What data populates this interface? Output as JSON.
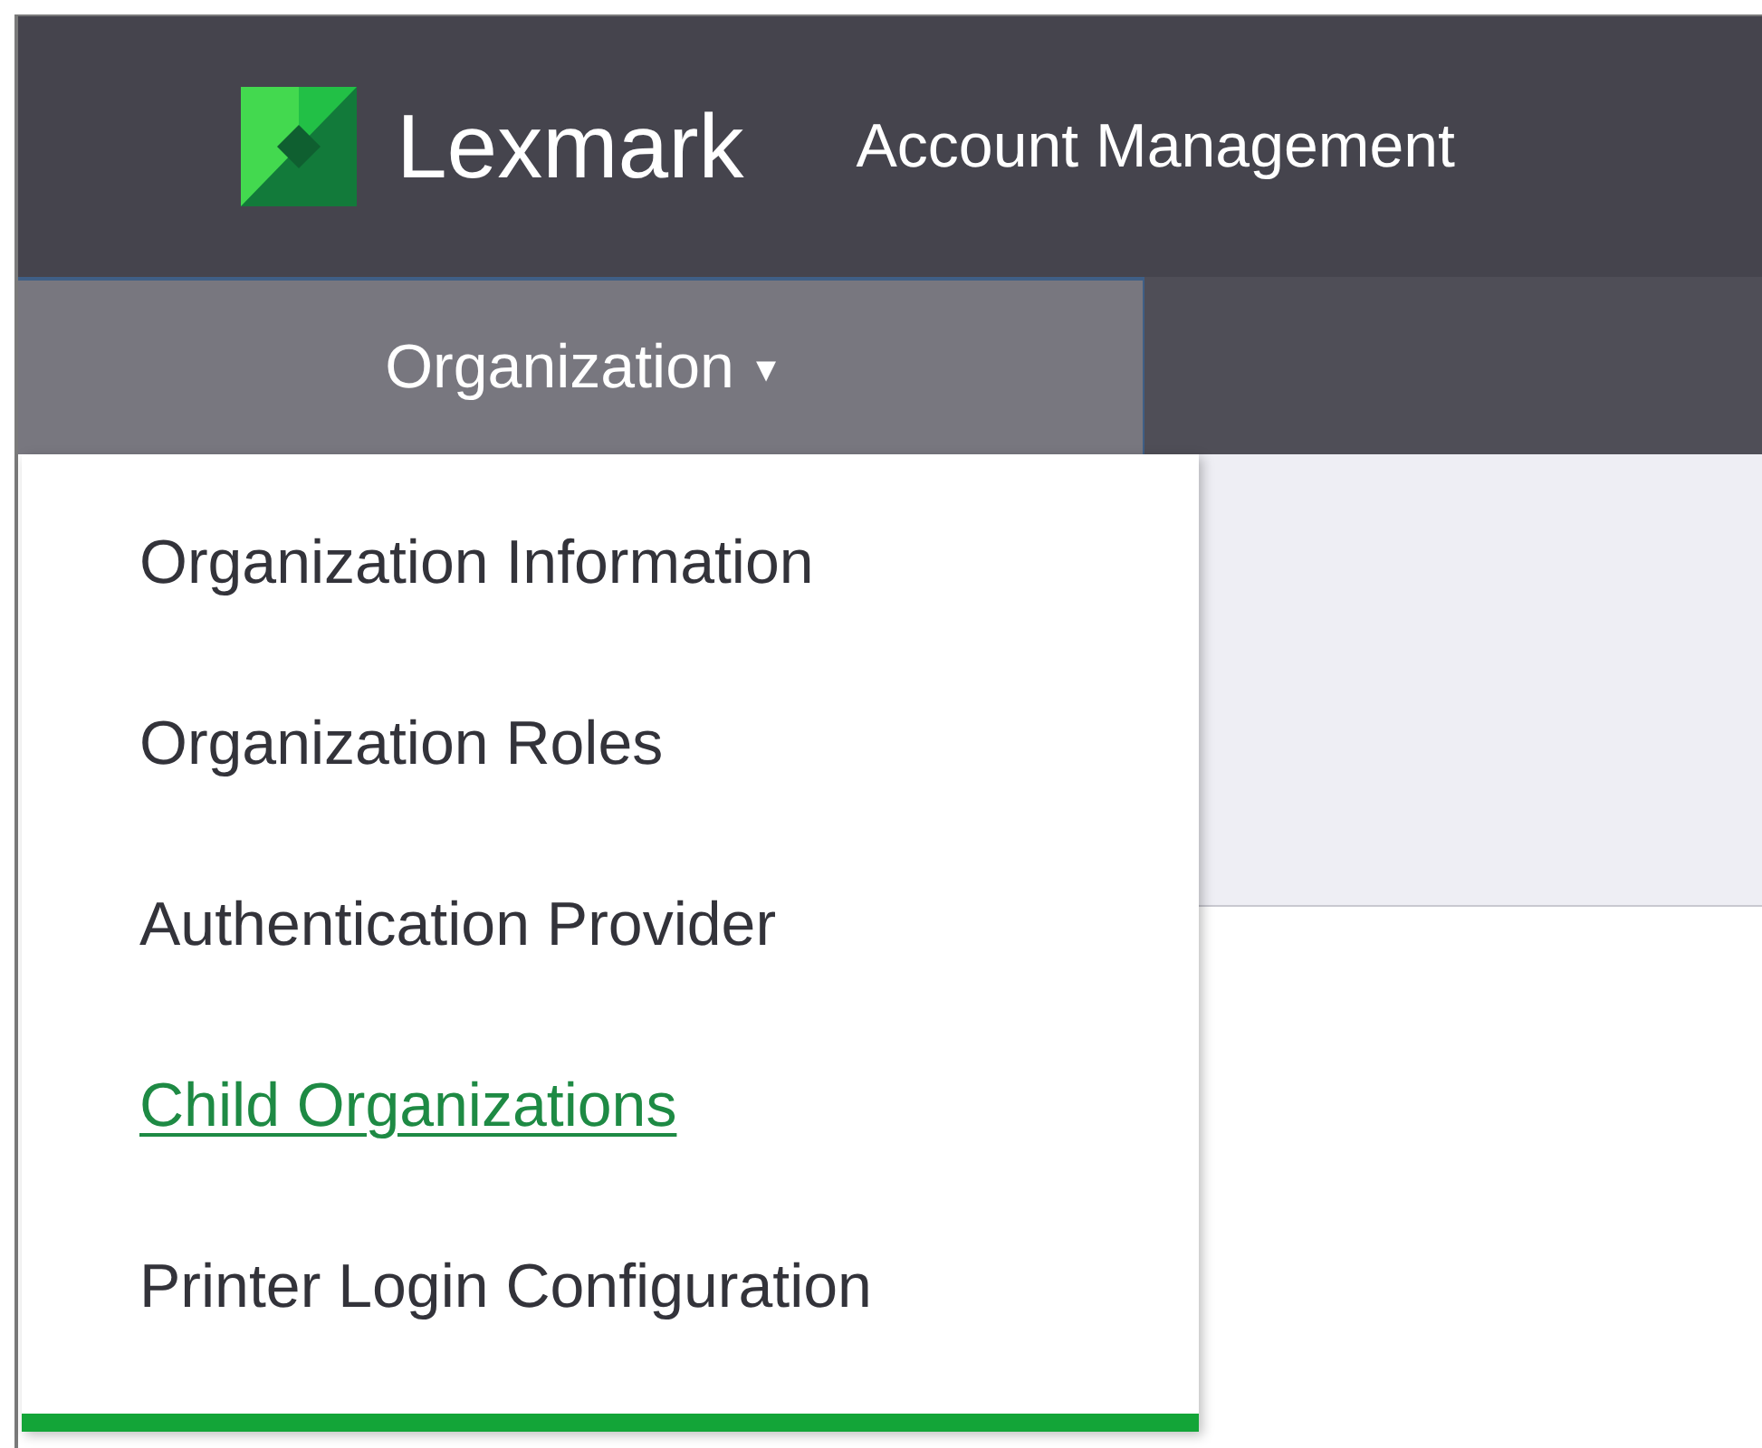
{
  "header": {
    "brand": "Lexmark",
    "app_title": "Account Management"
  },
  "nav": [
    {
      "label": "Organization",
      "caret": "▾",
      "expanded": true
    }
  ],
  "menu": [
    {
      "label": "Organization Information",
      "selected": false
    },
    {
      "label": "Organization Roles",
      "selected": false
    },
    {
      "label": "Authentication Provider",
      "selected": false
    },
    {
      "label": "Child Organizations",
      "selected": true
    },
    {
      "label": "Printer Login Configuration",
      "selected": false
    }
  ]
}
